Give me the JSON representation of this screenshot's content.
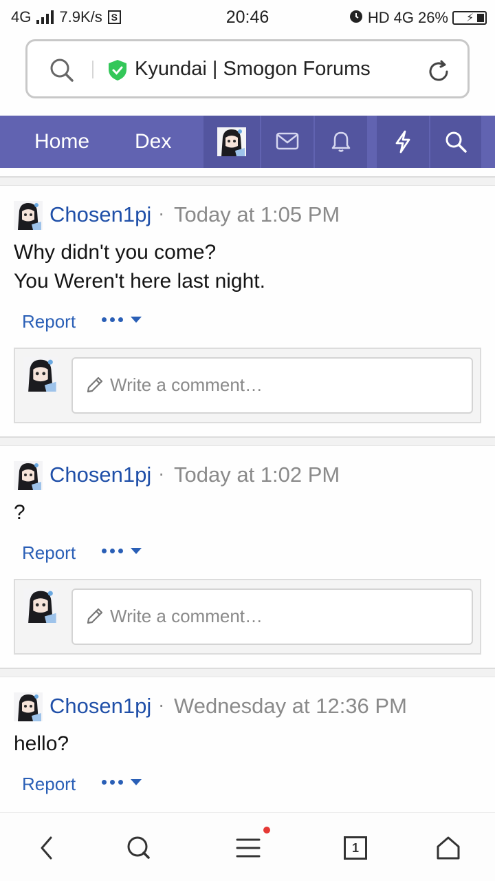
{
  "status_bar": {
    "network": "4G",
    "speed": "7.9K/s",
    "s_badge": "S",
    "time": "20:46",
    "hd": "HD",
    "network_right": "4G",
    "battery": "26%"
  },
  "browser": {
    "page_title": "Kyundai | Smogon Forums"
  },
  "nav": {
    "home": "Home",
    "dex": "Dex"
  },
  "posts": [
    {
      "author": "Chosen1pj",
      "separator": "·",
      "time": "Today at 1:05 PM",
      "lines": [
        "Why didn't you come?",
        "You Weren't here last night."
      ],
      "report": "Report",
      "comment_placeholder": "Write a comment…"
    },
    {
      "author": "Chosen1pj",
      "separator": "·",
      "time": "Today at 1:02 PM",
      "lines": [
        "?"
      ],
      "report": "Report",
      "comment_placeholder": "Write a comment…"
    },
    {
      "author": "Chosen1pj",
      "separator": "·",
      "time": "Wednesday at 12:36 PM",
      "lines": [
        "hello?"
      ],
      "report": "Report"
    }
  ],
  "bottom_bar": {
    "tab_count": "1",
    "menu_has_notification": true
  },
  "colors": {
    "nav_bg": "#6163b1",
    "link": "#1f4fa8",
    "shield": "#34c759",
    "notification": "#e53935"
  },
  "icons": [
    "search-icon",
    "shield-icon",
    "reload-icon",
    "mail-icon",
    "bell-icon",
    "lightning-icon",
    "pencil-icon",
    "back-icon",
    "menu-icon",
    "home-icon"
  ]
}
